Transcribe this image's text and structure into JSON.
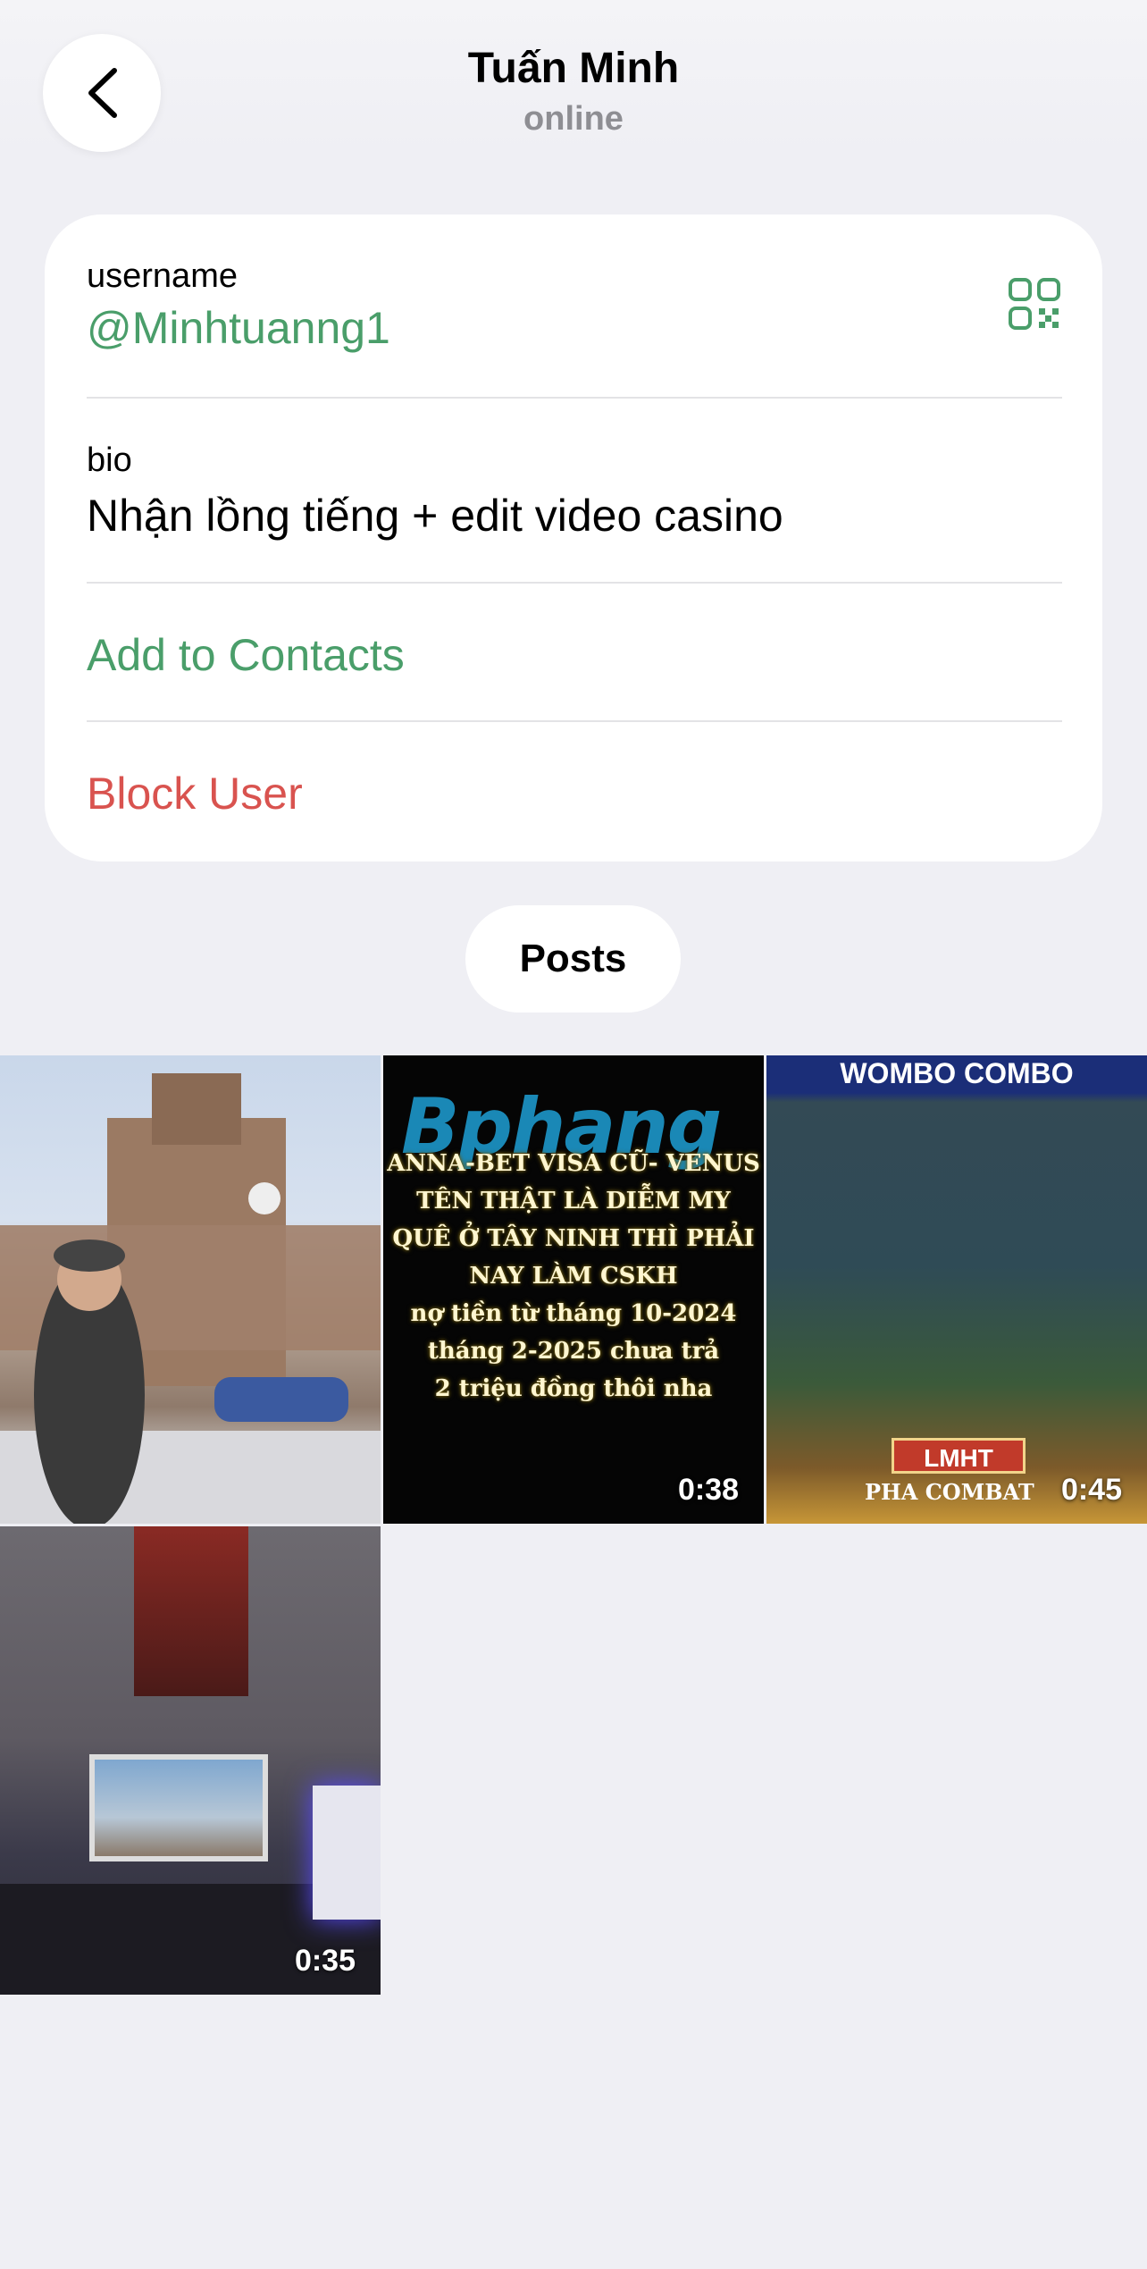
{
  "header": {
    "title": "Tuấn Minh",
    "status": "online",
    "back_icon": "chevron-left-icon"
  },
  "profile": {
    "username_label": "username",
    "username_value": "@Minhtuanng1",
    "qr_icon": "qr-code-icon",
    "bio_label": "bio",
    "bio_value": "Nhận lồng tiếng + edit video casino",
    "add_contact_label": "Add to Contacts",
    "block_label": "Block User"
  },
  "tabs": {
    "posts_label": "Posts"
  },
  "posts": [
    {
      "duration": ""
    },
    {
      "duration": "0:38",
      "overlay_logo": "Bphang",
      "caption_lines": [
        "ANNA-BET VISA CŨ- VENUS",
        "TÊN THẬT LÀ DIỄM MY",
        "QUÊ Ở TÂY NINH THÌ PHẢI",
        "NAY LÀM CSKH",
        "nợ tiền từ tháng 10-2024",
        "tháng 2-2025 chưa trả",
        "2 triệu đồng thôi nha"
      ]
    },
    {
      "duration": "0:45",
      "banner": "WOMBO COMBO",
      "badge": "LMHT",
      "footer_text": "PHA COMBAT"
    },
    {
      "duration": "0:35"
    }
  ],
  "colors": {
    "accent_green": "#4a9e6a",
    "destructive_red": "#d9534f",
    "background": "#efeff4"
  }
}
